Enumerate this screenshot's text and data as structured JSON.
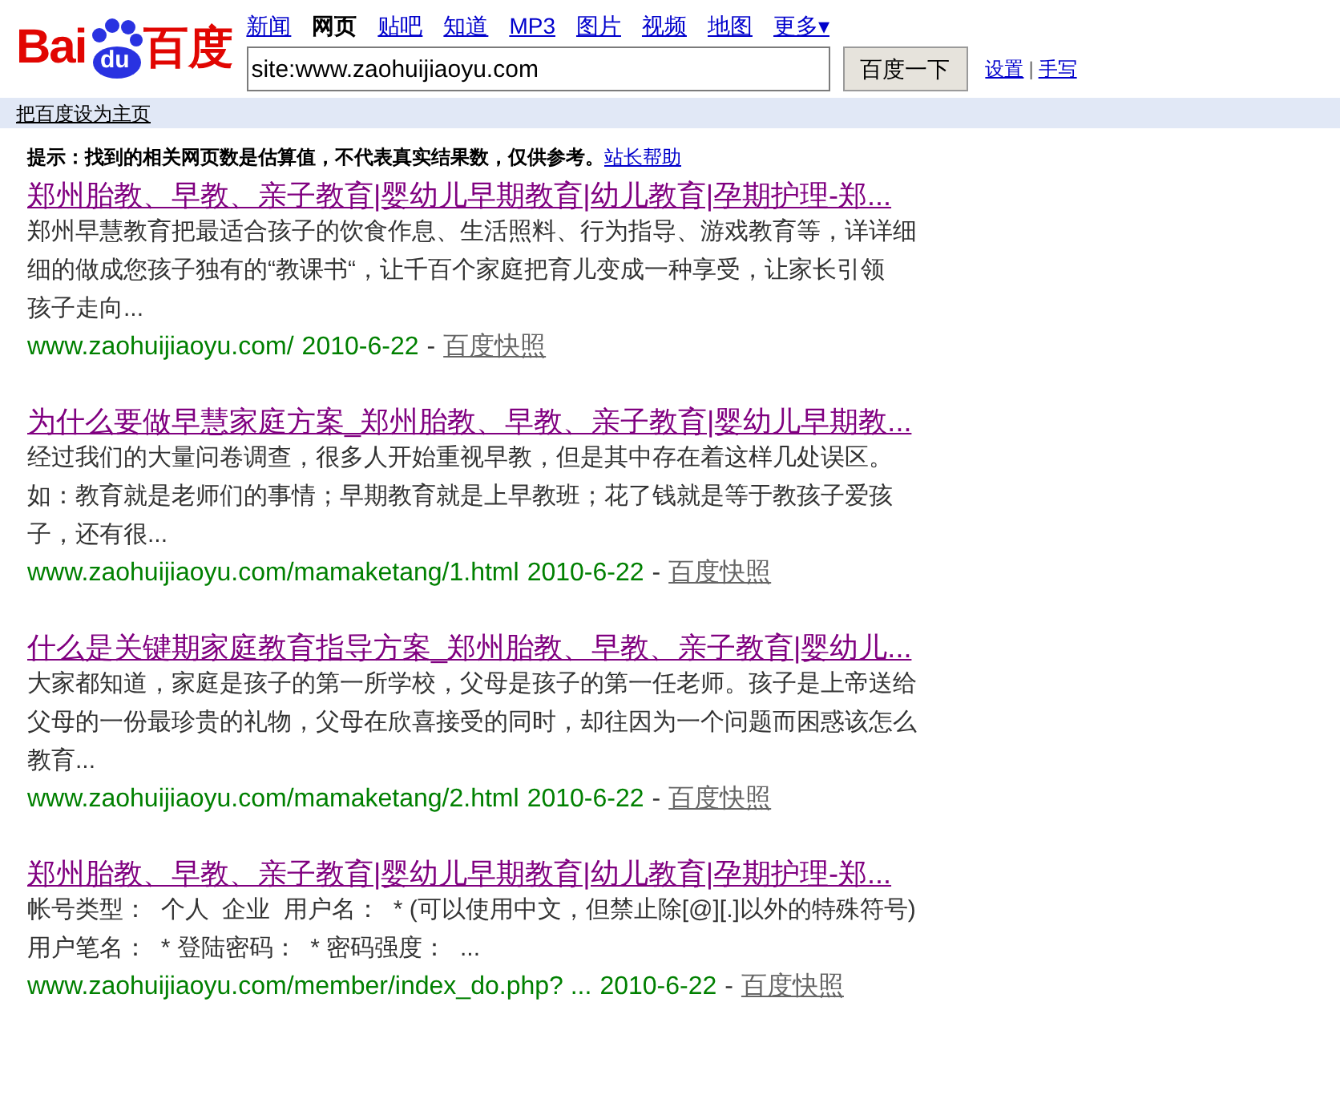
{
  "logo": {
    "left": "Bai",
    "paw": "du",
    "right": "百度"
  },
  "nav": [
    {
      "label": "新闻",
      "selected": false
    },
    {
      "label": "网页",
      "selected": true
    },
    {
      "label": "贴吧",
      "selected": false
    },
    {
      "label": "知道",
      "selected": false
    },
    {
      "label": "MP3",
      "selected": false
    },
    {
      "label": "图片",
      "selected": false
    },
    {
      "label": "视频",
      "selected": false
    },
    {
      "label": "地图",
      "selected": false
    },
    {
      "label": "更多▾",
      "selected": false
    }
  ],
  "search": {
    "value": "site:www.zaohuijiaoyu.com",
    "button": "百度一下"
  },
  "links": [
    "设置",
    "手写"
  ],
  "links_separator": "|",
  "set_home": "把百度设为主页",
  "notice": {
    "text": "提示：找到的相关网页数是估算值，不代表真实结果数，仅供参考。",
    "link": "站长帮助"
  },
  "results": [
    {
      "title": "郑州胎教、早教、亲子教育|婴幼儿早期教育|幼儿教育|孕期护理-郑...",
      "snippet": [
        "郑州早慧教育把最适合孩子的饮食作息、生活照料、行为指导、游戏教育等，详详细",
        "细的做成您孩子独有的“教课书“，让千百个家庭把育儿变成一种享受，让家长引领",
        "孩子走向..."
      ],
      "url": "www.zaohuijiaoyu.com/",
      "date": "2010-6-22",
      "separator": "-",
      "cache": "百度快照"
    },
    {
      "title": "为什么要做早慧家庭方案_郑州胎教、早教、亲子教育|婴幼儿早期教...",
      "snippet": [
        "经过我们的大量问卷调查，很多人开始重视早教，但是其中存在着这样几处误区。",
        "如：教育就是老师们的事情；早期教育就是上早教班；花了钱就是等于教孩子爱孩",
        "子，还有很..."
      ],
      "url": "www.zaohuijiaoyu.com/mamaketang/1.html",
      "date": "2010-6-22",
      "separator": "-",
      "cache": "百度快照"
    },
    {
      "title": "什么是关键期家庭教育指导方案_郑州胎教、早教、亲子教育|婴幼儿...",
      "snippet": [
        "大家都知道，家庭是孩子的第一所学校，父母是孩子的第一任老师。孩子是上帝送给",
        "父母的一份最珍贵的礼物，父母在欣喜接受的同时，却往因为一个问题而困惑该怎么",
        "教育..."
      ],
      "url": "www.zaohuijiaoyu.com/mamaketang/2.html",
      "date": "2010-6-22",
      "separator": "-",
      "cache": "百度快照"
    },
    {
      "title": "郑州胎教、早教、亲子教育|婴幼儿早期教育|幼儿教育|孕期护理-郑...",
      "snippet": [
        "帐号类型：  个人  企业  用户名：  * (可以使用中文，但禁止除[@][.]以外的特殊符号)",
        "用户笔名：  * 登陆密码：  * 密码强度：  ..."
      ],
      "url": "www.zaohuijiaoyu.com/member/index_do.php? ...",
      "date": "2010-6-22",
      "separator": "-",
      "cache": "百度快照"
    }
  ]
}
